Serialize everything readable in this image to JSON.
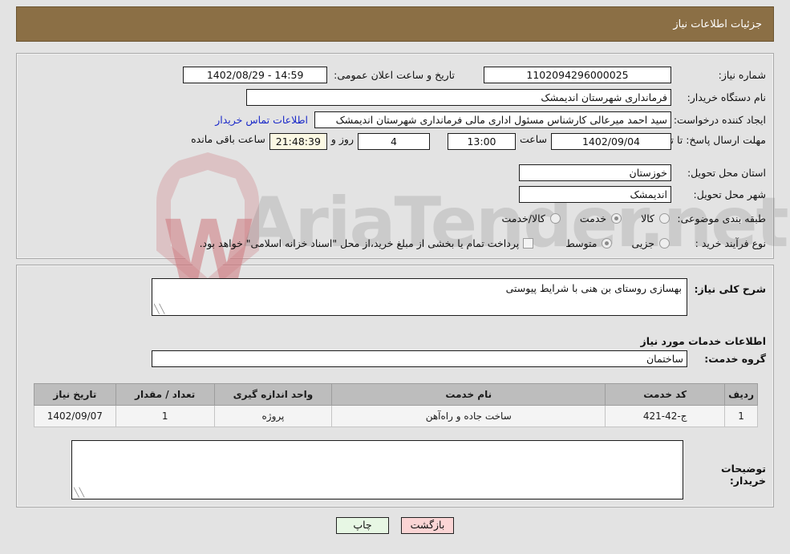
{
  "header": {
    "title": "جزئیات اطلاعات نیاز"
  },
  "watermark": {
    "text": "AriaTender.net",
    "logo_letter": "W"
  },
  "top_section": {
    "need_number": {
      "label": "شماره نیاز:",
      "value": "1102094296000025"
    },
    "announce_datetime": {
      "label": "تاریخ و ساعت اعلان عمومی:",
      "value": "14:59 - 1402/08/29"
    },
    "buyer_org": {
      "label": "نام دستگاه خریدار:",
      "value": "فرمانداری شهرستان اندیمشک"
    },
    "request_creator": {
      "label": "ایجاد کننده درخواست:",
      "value": "سید احمد میرعالی کارشناس مسئول اداری مالی فرمانداری شهرستان اندیمشک",
      "contact_link": "اطلاعات تماس خریدار"
    },
    "deadline": {
      "label": "مهلت ارسال پاسخ: تا تاریخ:",
      "date": "1402/09/04",
      "hour_label": "ساعت",
      "time": "13:00",
      "days": "4",
      "days_label": "روز و",
      "countdown": "21:48:39",
      "remaining_label": "ساعت باقی مانده"
    },
    "delivery_province": {
      "label": "استان محل تحویل:",
      "value": "خوزستان"
    },
    "delivery_city": {
      "label": "شهر محل تحویل:",
      "value": "اندیمشک"
    },
    "category": {
      "label": "طبقه بندی موضوعی:",
      "options": [
        {
          "label": "کالا",
          "selected": false
        },
        {
          "label": "خدمت",
          "selected": true
        },
        {
          "label": "کالا/خدمت",
          "selected": false
        }
      ]
    },
    "purchase_process": {
      "label": "نوع فرآیند خرید :",
      "options": [
        {
          "label": "جزیی",
          "selected": false
        },
        {
          "label": "متوسط",
          "selected": true
        }
      ],
      "treasury_note": "پرداخت تمام یا بخشی از مبلغ خرید،از محل \"اسناد خزانه اسلامی\" خواهد بود.",
      "treasury_checked": false
    }
  },
  "bottom_section": {
    "need_description": {
      "label": "شرح کلی نیاز:",
      "value": "بهسازی روستای بن هنی با شرایط پیوستی"
    },
    "services_heading": "اطلاعات خدمات مورد نیاز",
    "service_group": {
      "label": "گروه خدمت:",
      "value": "ساختمان"
    },
    "table": {
      "columns": [
        "ردیف",
        "کد خدمت",
        "نام خدمت",
        "واحد اندازه گیری",
        "تعداد / مقدار",
        "تاریخ نیاز"
      ],
      "rows": [
        [
          "1",
          "ج-42-421",
          "ساخت جاده و راه‌آهن",
          "پروژه",
          "1",
          "1402/09/07"
        ]
      ]
    },
    "buyer_notes": {
      "label": "توضیحات خریدار:",
      "value": ""
    }
  },
  "footer": {
    "print_label": "چاپ",
    "back_label": "بازگشت"
  },
  "colors": {
    "header_bg": "#8b6f45",
    "page_bg": "#e3e3e3",
    "link": "#1a29c8",
    "table_header_bg": "#bdbdbd",
    "countdown_bg": "#fbf8e3",
    "print_btn_bg": "#e7f7e4",
    "back_btn_bg": "#fbd5d5"
  }
}
